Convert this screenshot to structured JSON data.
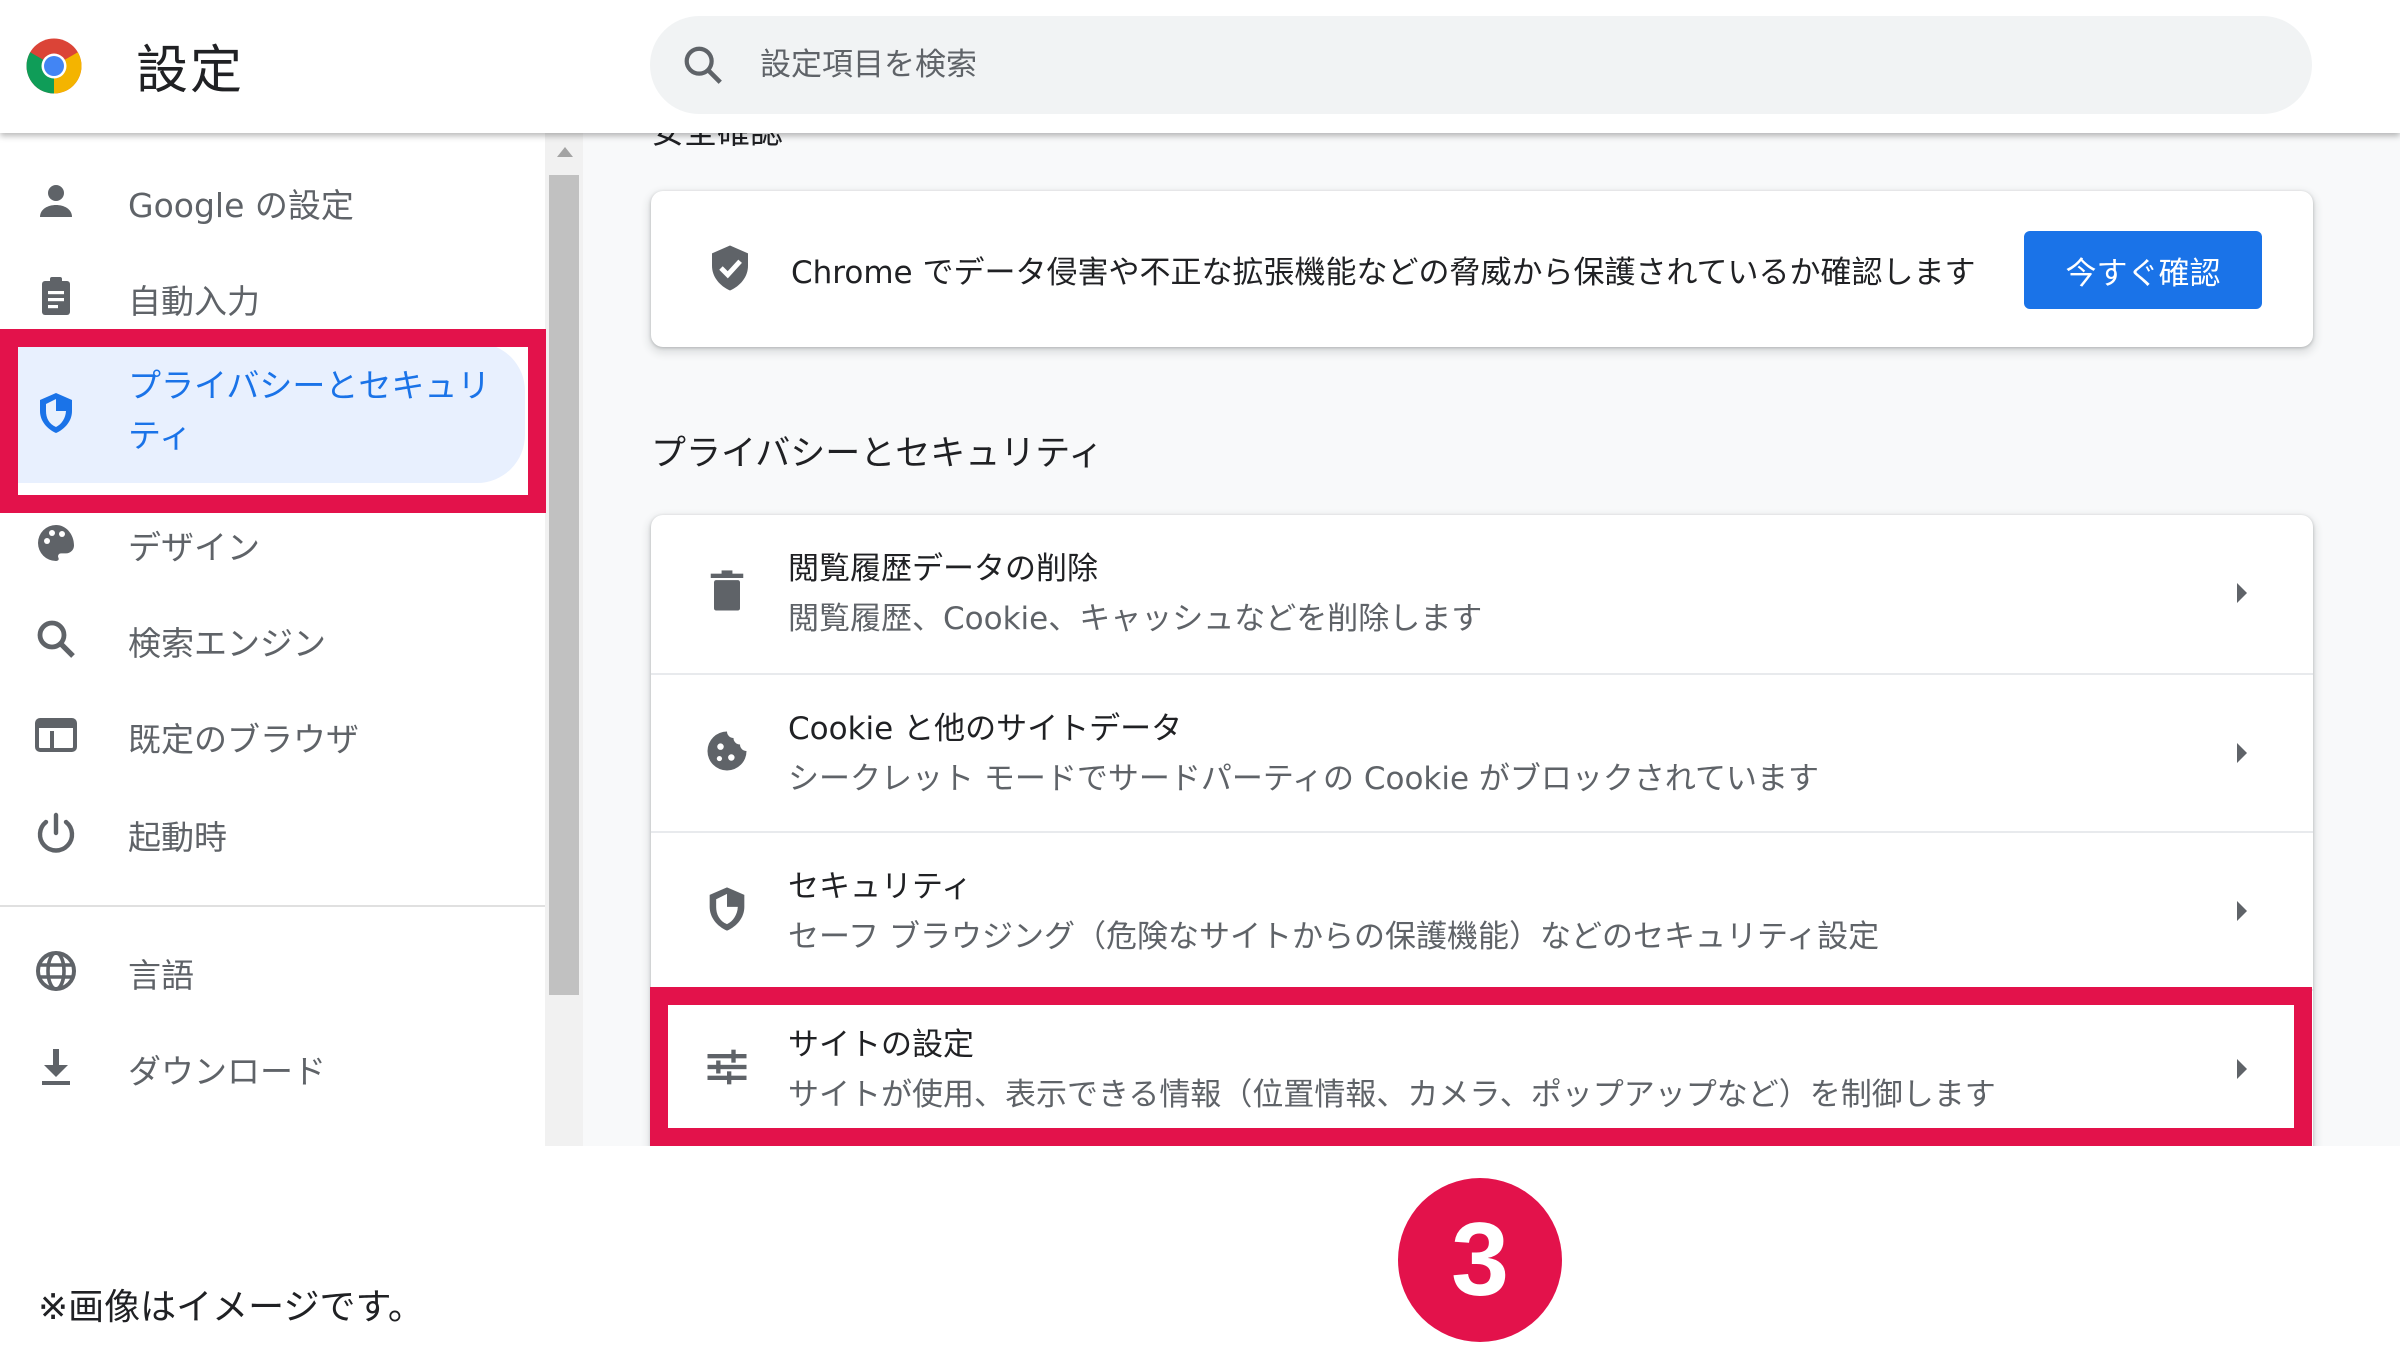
{
  "header": {
    "title": "設定",
    "search_placeholder": "設定項目を検索"
  },
  "sidebar": {
    "items": [
      {
        "label": "Google の設定",
        "icon": "person-icon"
      },
      {
        "label": "自動入力",
        "icon": "clipboard-icon"
      },
      {
        "label": "プライバシーとセキュリティ",
        "icon": "shield-icon",
        "active": true
      },
      {
        "label": "デザイン",
        "icon": "palette-icon"
      },
      {
        "label": "検索エンジン",
        "icon": "search-icon"
      },
      {
        "label": "既定のブラウザ",
        "icon": "browser-icon"
      },
      {
        "label": "起動時",
        "icon": "power-icon"
      },
      {
        "label": "言語",
        "icon": "globe-icon"
      },
      {
        "label": "ダウンロード",
        "icon": "download-icon"
      }
    ]
  },
  "main": {
    "cut_heading": "安全確認",
    "safety_check": {
      "text": "Chrome でデータ侵害や不正な拡張機能などの脅威から保護されているか確認します",
      "button": "今すぐ確認"
    },
    "section_title": "プライバシーとセキュリティ",
    "rows": [
      {
        "title": "閲覧履歴データの削除",
        "subtitle": "閲覧履歴、Cookie、キャッシュなどを削除します",
        "icon": "trash-icon"
      },
      {
        "title": "Cookie と他のサイトデータ",
        "subtitle": "シークレット モードでサードパーティの Cookie がブロックされています",
        "icon": "cookie-icon"
      },
      {
        "title": "セキュリティ",
        "subtitle": "セーフ ブラウジング（危険なサイトからの保護機能）などのセキュリティ設定",
        "icon": "shield-icon"
      },
      {
        "title": "サイトの設定",
        "subtitle": "サイトが使用、表示できる情報（位置情報、カメラ、ポップアップなど）を制御します",
        "icon": "sliders-icon"
      }
    ]
  },
  "annotations": {
    "note": "※画像はイメージです。",
    "step_number": "3",
    "highlight_color": "#e3124b"
  },
  "colors": {
    "accent": "#1a73e8",
    "active_bg": "#e8f0fe"
  }
}
